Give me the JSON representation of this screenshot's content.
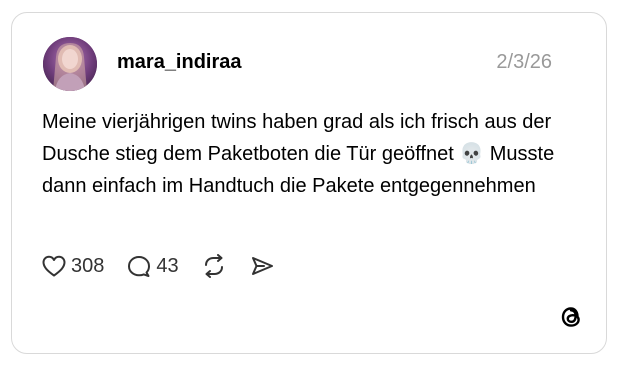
{
  "post": {
    "username": "mara_indiraa",
    "date": "2/3/26",
    "text": "Meine vierjährigen twins haben grad als ich frisch aus der Dusche stieg dem Paketboten die Tür geöffnet 💀 Musste dann einfach im Handtuch die Pakete entgegennehmen",
    "likes": "308",
    "replies": "43"
  },
  "icons": {
    "like": "heart-icon",
    "reply": "speech-bubble-icon",
    "repost": "repost-icon",
    "share": "send-icon",
    "brand": "threads-logo-icon"
  },
  "colors": {
    "border": "#d9d9d9",
    "text": "#000000",
    "muted": "#999999"
  }
}
